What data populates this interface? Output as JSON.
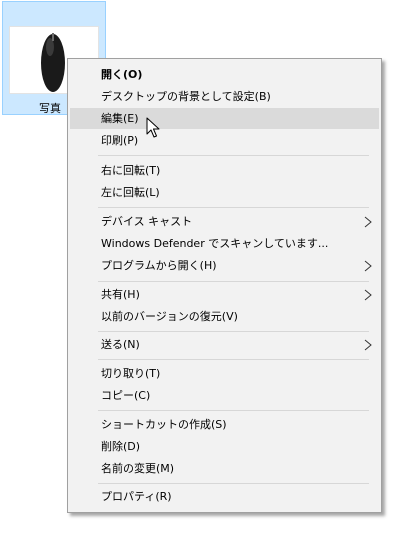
{
  "file": {
    "label": "写真"
  },
  "menu": {
    "items": [
      {
        "label": "開く(O)",
        "bold": true
      },
      {
        "label": "デスクトップの背景として設定(B)"
      },
      {
        "label": "編集(E)",
        "highlighted": true
      },
      {
        "label": "印刷(P)"
      },
      {
        "label": "右に回転(T)"
      },
      {
        "label": "左に回転(L)"
      },
      {
        "label": "デバイス キャスト",
        "submenu": true
      },
      {
        "label": "Windows Defender でスキャンしています..."
      },
      {
        "label": "プログラムから開く(H)",
        "submenu": true
      },
      {
        "label": "共有(H)",
        "submenu": true
      },
      {
        "label": "以前のバージョンの復元(V)"
      },
      {
        "label": "送る(N)",
        "submenu": true
      },
      {
        "label": "切り取り(T)"
      },
      {
        "label": "コピー(C)"
      },
      {
        "label": "ショートカットの作成(S)"
      },
      {
        "label": "削除(D)"
      },
      {
        "label": "名前の変更(M)"
      },
      {
        "label": "プロパティ(R)"
      }
    ]
  },
  "colors": {
    "selection_bg": "#cce8ff",
    "menu_bg": "#f2f2f2",
    "highlight_bg": "#dadada"
  },
  "icons": {
    "submenu_arrow": "chevron-right-icon",
    "pointer": "mouse-pointer-icon"
  }
}
